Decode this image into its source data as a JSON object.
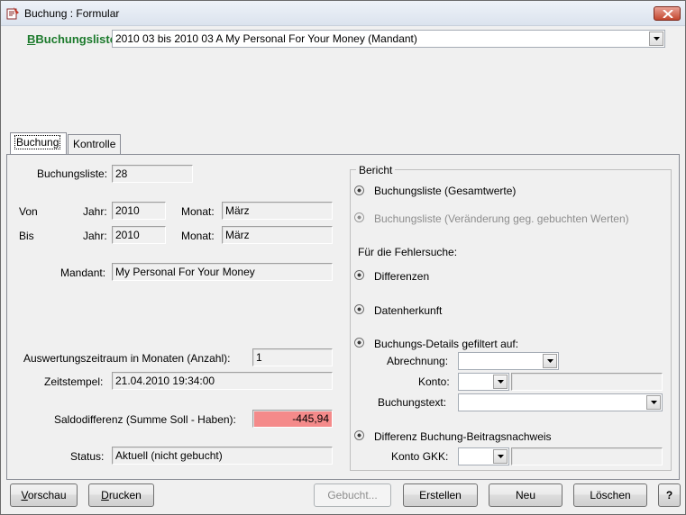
{
  "window": {
    "title": "Buchung : Formular",
    "icon": "app-icon"
  },
  "header": {
    "label": "Buchungsliste:",
    "combo_value": "2010 03 bis 2010 03 A My Personal For Your Money (Mandant)",
    "label_color": "#1c7a2c"
  },
  "tabs": [
    {
      "label": "Buchung",
      "active": true
    },
    {
      "label": "Kontrolle",
      "active": false
    }
  ],
  "form": {
    "buchungsliste_label": "Buchungsliste:",
    "buchungsliste_value": "28",
    "von_label": "Von",
    "bis_label": "Bis",
    "jahr_label": "Jahr:",
    "monat_label": "Monat:",
    "von_jahr": "2010",
    "von_monat": "März",
    "bis_jahr": "2010",
    "bis_monat": "März",
    "mandant_label": "Mandant:",
    "mandant_value": "My Personal For Your Money",
    "auswertung_label": "Auswertungszeitraum in Monaten (Anzahl):",
    "auswertung_value": "1",
    "zeitstempel_label": "Zeitstempel:",
    "zeitstempel_value": "21.04.2010 19:34:00",
    "saldo_label": "Saldodifferenz (Summe Soll - Haben):",
    "saldo_value": "-445,94",
    "saldo_color": "#f48a8a",
    "status_label": "Status:",
    "status_value": "Aktuell (nicht gebucht)"
  },
  "bericht": {
    "title": "Bericht",
    "option1": "Buchungsliste (Gesamtwerte)",
    "option2": "Buchungsliste (Veränderung geg. gebuchten Werten)",
    "fehlersuche_label": "Für die Fehlersuche:",
    "option3": "Differenzen",
    "option4": "Datenherkunft",
    "option5": "Buchungs-Details gefiltert auf:",
    "abrechnung_label": "Abrechnung:",
    "abrechnung_value": "",
    "konto_label": "Konto:",
    "konto_value": "",
    "konto_text": "",
    "buchungstext_label": "Buchungstext:",
    "buchungstext_value": "",
    "option6": "Differenz Buchung-Beitragsnachweis",
    "konto_gkk_label": "Konto GKK:",
    "konto_gkk_value": "",
    "konto_gkk_text": ""
  },
  "buttons": {
    "vorschau": "orschau",
    "vorschau_key": "V",
    "drucken": "rucken",
    "drucken_key": "D",
    "gebucht": "Gebucht...",
    "erstellen": "Erstellen",
    "neu": "Neu",
    "loeschen": "Löschen",
    "help": "?"
  }
}
